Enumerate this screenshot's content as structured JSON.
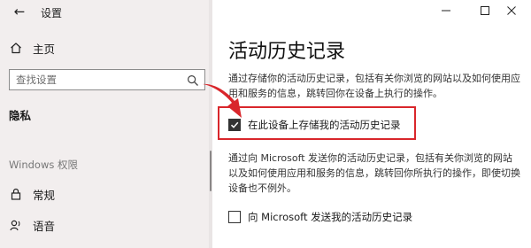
{
  "window": {
    "app_title": "设置",
    "controls": {
      "minimize": "—",
      "maximize": "☐",
      "close": "✕"
    }
  },
  "sidebar": {
    "home_label": "主页",
    "search_placeholder": "查找设置",
    "section_heading": "隐私",
    "group_label": "Windows 权限",
    "items": [
      {
        "label": "常规",
        "icon": "lock-icon"
      },
      {
        "label": "语音",
        "icon": "speech-icon"
      }
    ]
  },
  "main": {
    "title": "活动历史记录",
    "description_1": "通过存储你的活动历史记录，包括有关你浏览的网站以及如何使用应用和服务的信息，跳转回你在设备上执行的操作。",
    "checkbox_store_label": "在此设备上存储我的活动历史记录",
    "checkbox_store_checked": true,
    "description_2": "通过向 Microsoft 发送你的活动历史记录，包括有关你浏览的网站以及如何使用应用和服务的信息，跳转回你所执行的操作，即使切换设备也不例外。",
    "checkbox_send_label": "向 Microsoft 发送我的活动历史记录",
    "checkbox_send_checked": false
  },
  "colors": {
    "sidebar_bg": "#f2eeee",
    "annotation_red": "#d9262b",
    "checkbox_fill": "#333333"
  }
}
